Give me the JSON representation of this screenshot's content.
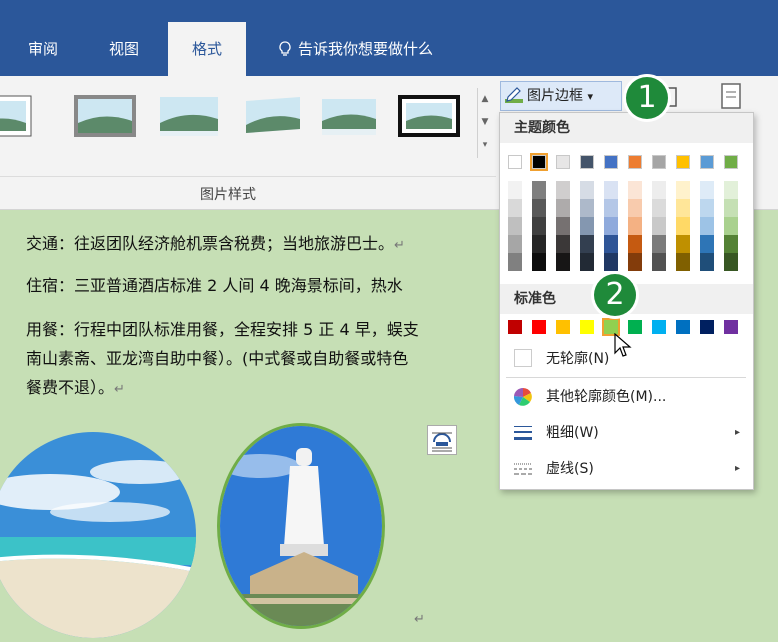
{
  "tabs": {
    "review": "审阅",
    "view": "视图",
    "format": "格式",
    "tell_me": "告诉我你想要做什么"
  },
  "ribbon": {
    "group_label": "图片样式",
    "border_button": "图片边框",
    "border_arrow": "▾"
  },
  "document": {
    "line1": "交通：往返团队经济舱机票含税费；当地旅游巴士。",
    "line2": "住宿：三亚普通酒店标准 2 人间 4 晚海景标间，热水",
    "line3": "用餐：行程中团队标准用餐，全程安排 5 正 4 早，蜈支",
    "line4": "南山素斋、亚龙湾自助中餐）。(中式餐或自助餐或特色",
    "line5": "餐费不退）。",
    "return_mark": "↵",
    "return_mark_bottom": "↵"
  },
  "dropdown": {
    "theme_colors_label": "主题颜色",
    "standard_colors_label": "标准色",
    "no_outline": "无轮廓(N)",
    "more_colors": "其他轮廓颜色(M)...",
    "weight": "粗细(W)",
    "dashes": "虚线(S)",
    "submenu_arrow": "▸",
    "theme_top_row": [
      "#ffffff",
      "#000000",
      "#e7e6e6",
      "#44546a",
      "#4472c4",
      "#ed7d31",
      "#a5a5a5",
      "#ffc000",
      "#5b9bd5",
      "#70ad47"
    ],
    "theme_shades": [
      [
        "#f2f2f2",
        "#7f7f7f",
        "#d0cece",
        "#d6dce5",
        "#d9e2f3",
        "#fbe5d6",
        "#ededed",
        "#fff2cc",
        "#deebf7",
        "#e2f0d9"
      ],
      [
        "#d9d9d9",
        "#595959",
        "#aeabab",
        "#adb9ca",
        "#b4c7e7",
        "#f8cbad",
        "#dbdbdb",
        "#ffe699",
        "#bdd7ee",
        "#c5e0b4"
      ],
      [
        "#bfbfbf",
        "#404040",
        "#767171",
        "#8497b0",
        "#8faadc",
        "#f4b183",
        "#c9c9c9",
        "#ffd966",
        "#9dc3e6",
        "#a9d18e"
      ],
      [
        "#a6a6a6",
        "#262626",
        "#3b3838",
        "#333f50",
        "#2f5597",
        "#c55a11",
        "#7b7b7b",
        "#bf9000",
        "#2e75b6",
        "#548235"
      ],
      [
        "#808080",
        "#0d0d0d",
        "#171616",
        "#222a35",
        "#203864",
        "#833c0b",
        "#525252",
        "#806000",
        "#1f4e79",
        "#385723"
      ]
    ],
    "standard": [
      "#c00000",
      "#ff0000",
      "#ffc000",
      "#ffff00",
      "#92d050",
      "#00b050",
      "#00b0f0",
      "#0070c0",
      "#002060",
      "#7030a0"
    ]
  },
  "badges": {
    "one": "1",
    "two": "2"
  },
  "colors": {
    "ribbon_blue": "#2b579a",
    "doc_green": "#c6dfb5",
    "badge_green": "#1f8a3a"
  }
}
